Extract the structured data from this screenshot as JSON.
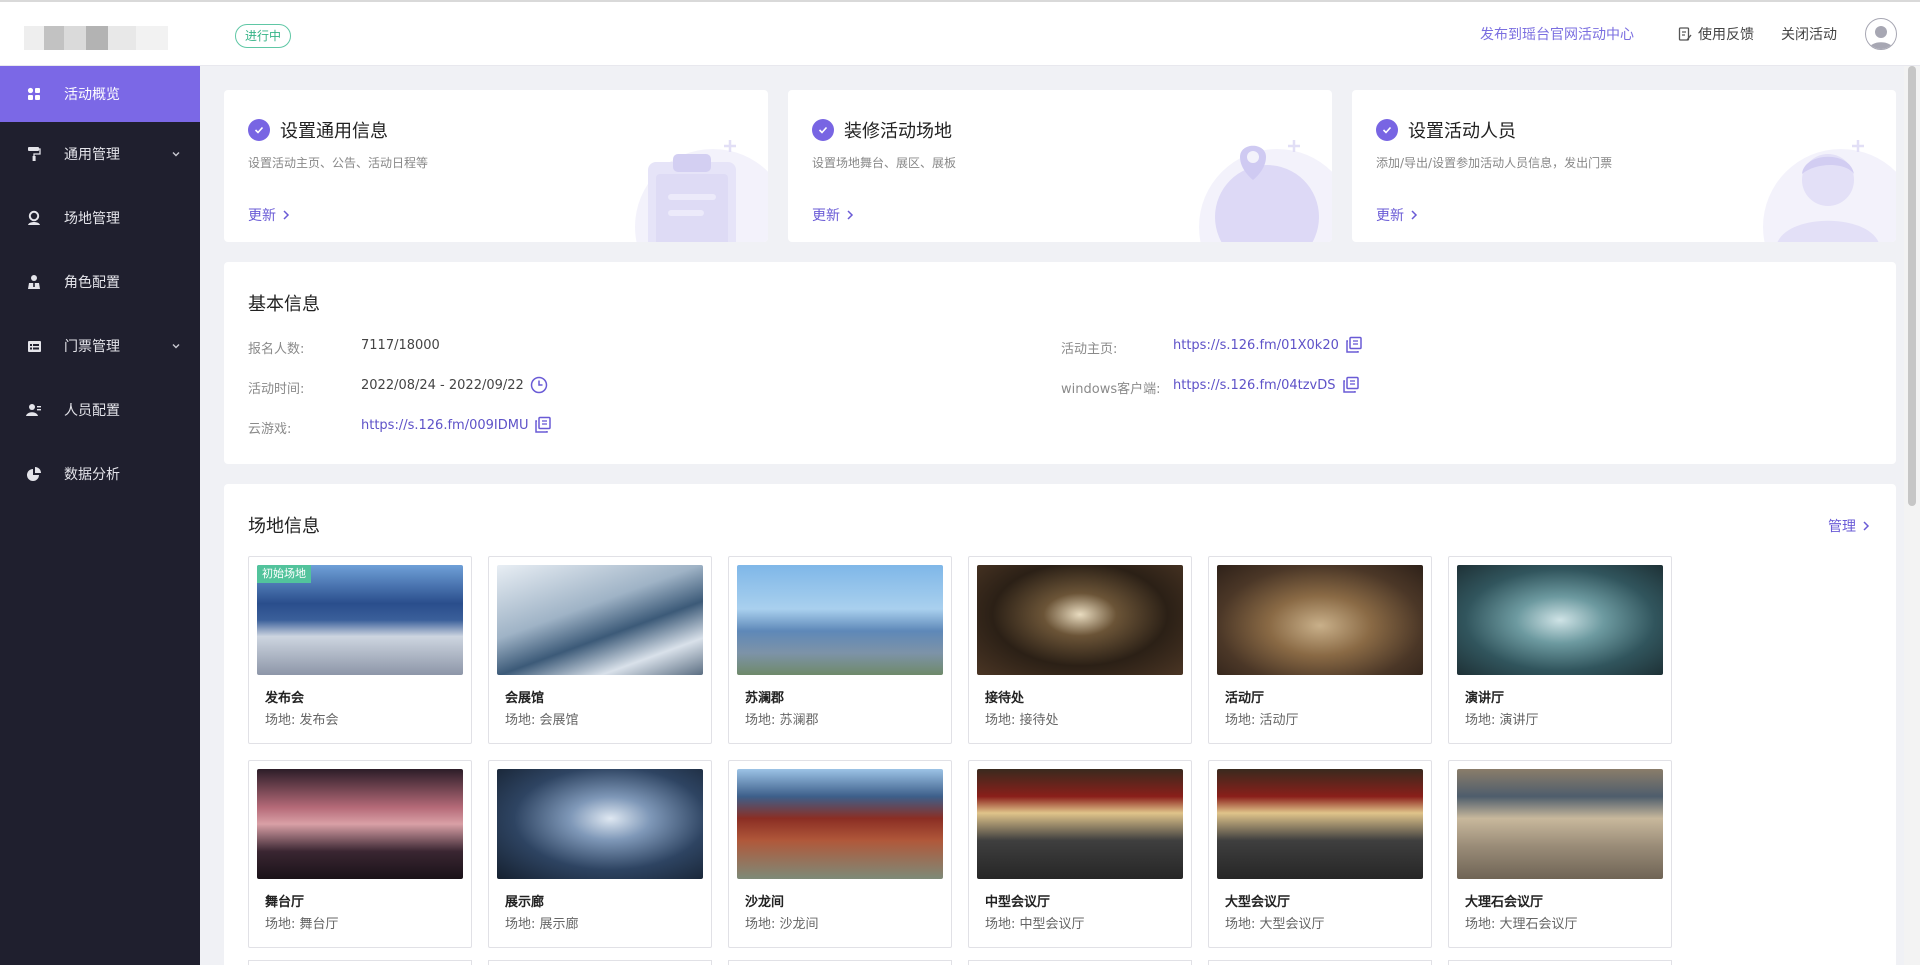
{
  "header": {
    "status": "进行中",
    "publish_link": "发布到瑶台官网活动中心",
    "feedback": "使用反馈",
    "close": "关闭活动"
  },
  "sidebar": {
    "items": [
      {
        "label": "活动概览",
        "icon": "dashboard-icon"
      },
      {
        "label": "通用管理",
        "icon": "paint-roller-icon"
      },
      {
        "label": "场地管理",
        "icon": "location-icon"
      },
      {
        "label": "角色配置",
        "icon": "person-icon"
      },
      {
        "label": "门票管理",
        "icon": "ticket-icon"
      },
      {
        "label": "人员配置",
        "icon": "users-icon"
      },
      {
        "label": "数据分析",
        "icon": "pie-chart-icon"
      }
    ]
  },
  "steps": [
    {
      "title": "设置通用信息",
      "desc": "设置活动主页、公告、活动日程等",
      "link": "更新"
    },
    {
      "title": "装修活动场地",
      "desc": "设置场地舞台、展区、展板",
      "link": "更新"
    },
    {
      "title": "设置活动人员",
      "desc": "添加/导出/设置参加活动人员信息，发出门票",
      "link": "更新"
    }
  ],
  "basic_info": {
    "title": "基本信息",
    "signup_label": "报名人数:",
    "signup_value": "7117/18000",
    "time_label": "活动时间:",
    "time_value": "2022/08/24 - 2022/09/22",
    "cloud_label": "云游戏:",
    "cloud_value": "https://s.126.fm/009IDMU",
    "home_label": "活动主页:",
    "home_value": "https://s.126.fm/01X0k20",
    "windows_label": "windows客户端:",
    "windows_value": "https://s.126.fm/04tzvDS"
  },
  "venues": {
    "title": "场地信息",
    "manage": "管理",
    "badge": "初始场地",
    "items": [
      {
        "name": "发布会",
        "sub": "场地: 发布会"
      },
      {
        "name": "会展馆",
        "sub": "场地: 会展馆"
      },
      {
        "name": "苏澜郡",
        "sub": "场地: 苏澜郡"
      },
      {
        "name": "接待处",
        "sub": "场地: 接待处"
      },
      {
        "name": "活动厅",
        "sub": "场地: 活动厅"
      },
      {
        "name": "演讲厅",
        "sub": "场地: 演讲厅"
      },
      {
        "name": "舞台厅",
        "sub": "场地: 舞台厅"
      },
      {
        "name": "展示廊",
        "sub": "场地: 展示廊"
      },
      {
        "name": "沙龙间",
        "sub": "场地: 沙龙间"
      },
      {
        "name": "中型会议厅",
        "sub": "场地: 中型会议厅"
      },
      {
        "name": "大型会议厅",
        "sub": "场地: 大型会议厅"
      },
      {
        "name": "大理石会议厅",
        "sub": "场地: 大理石会议厅"
      }
    ]
  },
  "colors": {
    "accent": "#7b68e6",
    "sidebar_bg": "#1f1f2e",
    "status_green": "#34b386"
  }
}
